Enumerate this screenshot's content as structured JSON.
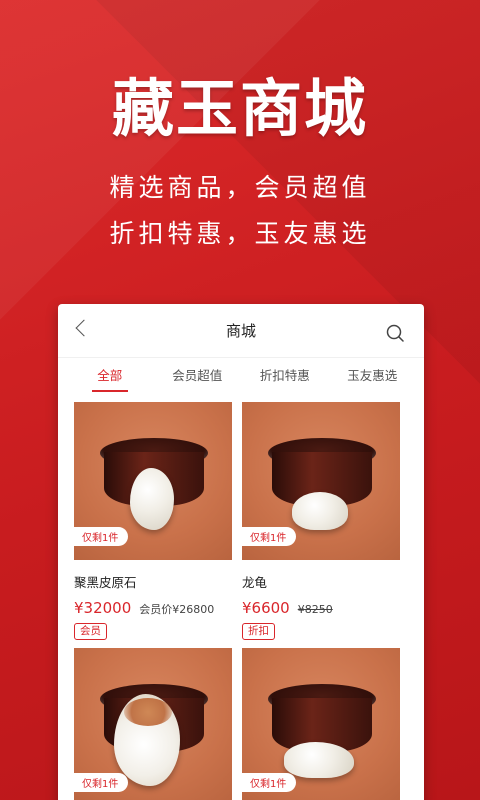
{
  "hero": {
    "title": "藏玉商城",
    "line1": "精选商品，会员超值",
    "line2": "折扣特惠，玉友惠选"
  },
  "navbar": {
    "title": "商城",
    "back_icon": "chevron-left-icon",
    "search_icon": "search-icon"
  },
  "tabs": [
    {
      "label": "全部",
      "active": true
    },
    {
      "label": "会员超值",
      "active": false
    },
    {
      "label": "折扣特惠",
      "active": false
    },
    {
      "label": "玉友惠选",
      "active": false
    }
  ],
  "products": [
    {
      "stock": "仅剩1件",
      "name": "聚黑皮原石",
      "price": "¥32000",
      "sub_price": "会员价¥26800",
      "badge": "会员"
    },
    {
      "stock": "仅剩1件",
      "name": "龙龟",
      "price": "¥6600",
      "sub_price": "¥8250",
      "badge": "折扣"
    },
    {
      "stock": "仅剩1件"
    },
    {
      "stock": "仅剩1件"
    }
  ],
  "colors": {
    "accent": "#d9262b",
    "background": "#d42324"
  }
}
